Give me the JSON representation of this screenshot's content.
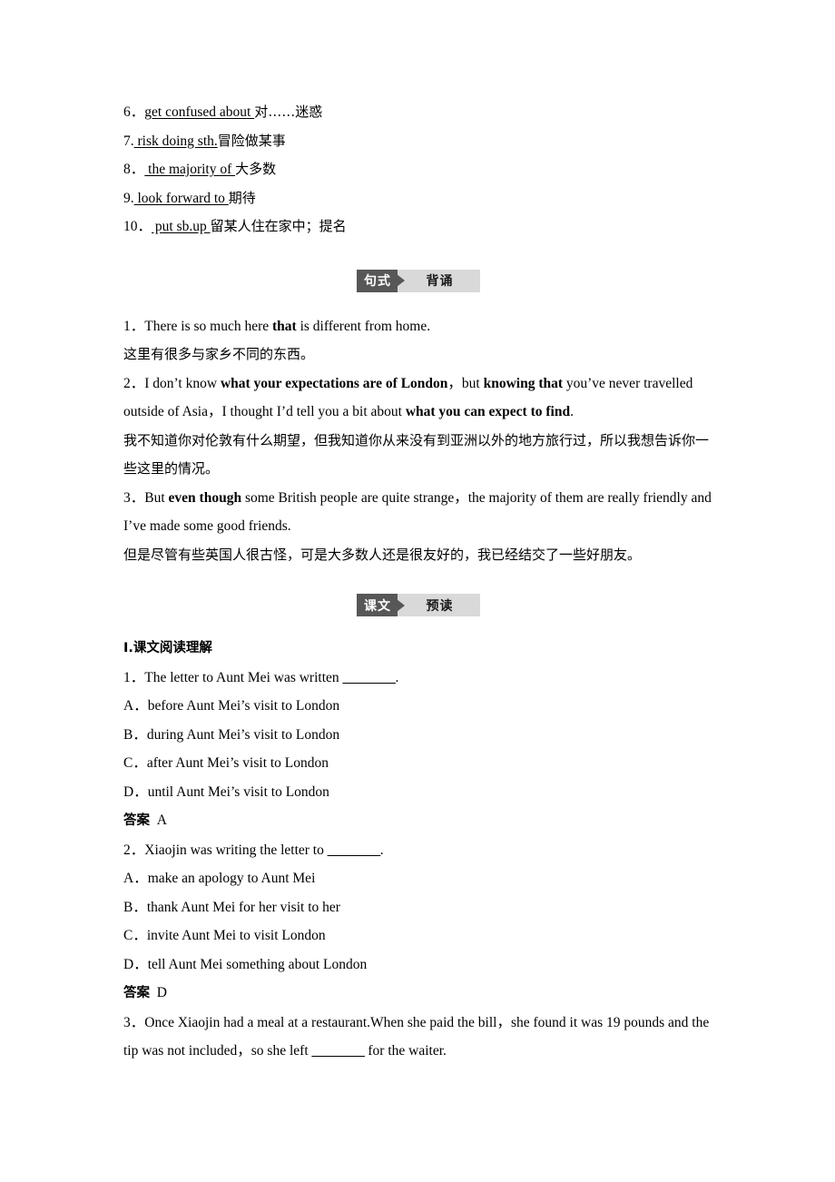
{
  "phrases": {
    "items": [
      {
        "num": "6．",
        "term": "get confused about ",
        "gloss": "对……迷惑"
      },
      {
        "num": "7.",
        "term": " risk doing sth.",
        "gloss": "冒险做某事"
      },
      {
        "num": "8．",
        "term": " the majority of ",
        "gloss": "大多数"
      },
      {
        "num": "9.",
        "term": " look forward to ",
        "gloss": " 期待"
      },
      {
        "num": "10．",
        "term": " put sb.up ",
        "gloss": "留某人住在家中；提名"
      }
    ]
  },
  "badge_sentences": {
    "left": "句式",
    "right": "背诵"
  },
  "badge_text": {
    "left": "课文",
    "right": "预读"
  },
  "sentences": [
    {
      "num": "1．",
      "en_parts": [
        {
          "t": "There is so much here ",
          "b": false
        },
        {
          "t": "that",
          "b": true
        },
        {
          "t": " is different from home.",
          "b": false
        }
      ],
      "cn": "这里有很多与家乡不同的东西。"
    },
    {
      "num": "2．",
      "en_parts": [
        {
          "t": "I don’t know ",
          "b": false
        },
        {
          "t": "what your expectations are of London",
          "b": true
        },
        {
          "t": "，but ",
          "b": false
        },
        {
          "t": "knowing that",
          "b": true
        },
        {
          "t": " you’ve never travelled outside of Asia，I thought I’d tell you a bit about ",
          "b": false
        },
        {
          "t": "what you can expect to find",
          "b": true
        },
        {
          "t": ".",
          "b": false
        }
      ],
      "cn": "我不知道你对伦敦有什么期望，但我知道你从来没有到亚洲以外的地方旅行过，所以我想告诉你一些这里的情况。"
    },
    {
      "num": "3．",
      "en_parts": [
        {
          "t": "But ",
          "b": false
        },
        {
          "t": "even though",
          "b": true
        },
        {
          "t": " some British people are quite strange，the majority of them are really friendly and I’ve made some good friends.",
          "b": false
        }
      ],
      "cn": "但是尽管有些英国人很古怪，可是大多数人还是很友好的，我已经结交了一些好朋友。"
    }
  ],
  "reading": {
    "heading": "Ⅰ.课文阅读理解",
    "answer_label": "答案",
    "blank": "________",
    "questions": [
      {
        "num": "1．",
        "stem_before": "The letter to Aunt Mei was written ",
        "stem_after": ".",
        "options": [
          "A．before Aunt Mei’s visit to London",
          "B．during Aunt Mei’s visit to London",
          "C．after Aunt Mei’s visit to London",
          "D．until Aunt Mei’s visit to London"
        ],
        "answer": "A"
      },
      {
        "num": "2．",
        "stem_before": "Xiaojin was writing the letter to ",
        "stem_after": ".",
        "options": [
          "A．make an apology to Aunt Mei",
          "B．thank Aunt Mei for her visit to her",
          "C．invite Aunt Mei to visit London",
          "D．tell Aunt Mei something about London"
        ],
        "answer": "D"
      }
    ],
    "question3": {
      "num": "3．",
      "part1": "Once Xiaojin had a meal at a restaurant.When she paid the bill，she found it was 19 pounds and the tip was not included，so she left ",
      "part2": " for the waiter."
    }
  }
}
